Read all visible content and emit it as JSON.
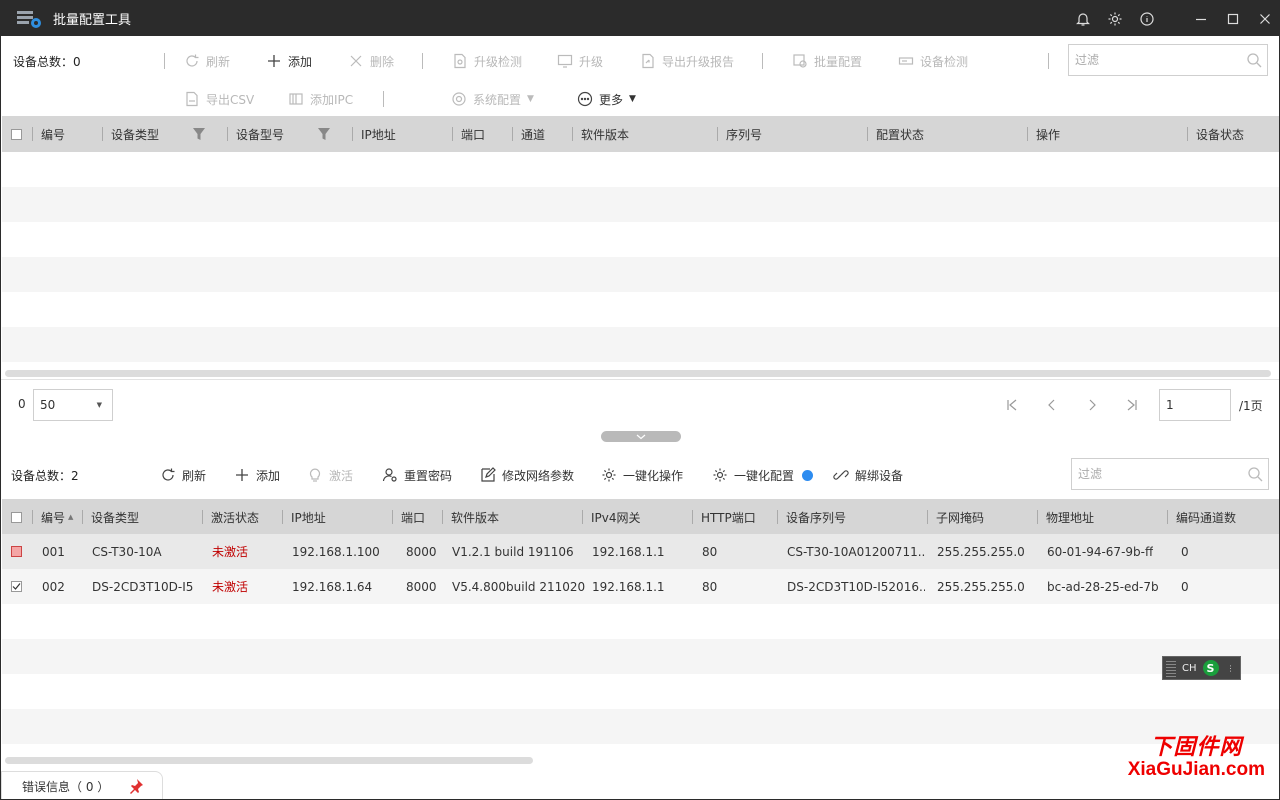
{
  "titlebar": {
    "title": "批量配置工具"
  },
  "top": {
    "total_label": "设备总数：0",
    "toolbar_row1": [
      "刷新",
      "添加",
      "删除",
      "升级检测",
      "升级",
      "导出升级报告",
      "批量配置",
      "设备检测"
    ],
    "toolbar_row2": [
      "导出CSV",
      "添加IPC",
      "系统配置",
      "更多"
    ],
    "filter_placeholder": "过滤",
    "columns": [
      "编号",
      "设备类型",
      "设备型号",
      "IP地址",
      "端口",
      "通道",
      "软件版本",
      "序列号",
      "配置状态",
      "操作",
      "设备状态"
    ]
  },
  "pager": {
    "count": "0",
    "page_size": "50",
    "page": "1",
    "page_total": "/1页"
  },
  "bottom": {
    "total_label": "设备总数：2",
    "toolbar": [
      "刷新",
      "添加",
      "激活",
      "重置密码",
      "修改网络参数",
      "一键化操作",
      "一键化配置",
      "解绑设备"
    ],
    "filter_placeholder": "过滤",
    "columns": [
      "编号",
      "设备类型",
      "激活状态",
      "IP地址",
      "端口",
      "软件版本",
      "IPv4网关",
      "HTTP端口",
      "设备序列号",
      "子网掩码",
      "物理地址",
      "编码通道数"
    ],
    "rows": [
      {
        "id": "001",
        "type": "CS-T30-10A",
        "status": "未激活",
        "ip": "192.168.1.100",
        "port": "8000",
        "version": "V1.2.1 build 191106",
        "gateway": "192.168.1.1",
        "http": "80",
        "serial": "CS-T30-10A01200711...",
        "mask": "255.255.255.0",
        "mac": "60-01-94-67-9b-ff",
        "channels": "0"
      },
      {
        "id": "002",
        "type": "DS-2CD3T10D-I5",
        "status": "未激活",
        "ip": "192.168.1.64",
        "port": "8000",
        "version": "V5.4.800build 211020",
        "gateway": "192.168.1.1",
        "http": "80",
        "serial": "DS-2CD3T10D-I52016...",
        "mask": "255.255.255.0",
        "mac": "bc-ad-28-25-ed-7b",
        "channels": "0"
      }
    ]
  },
  "ime": {
    "label": "CH"
  },
  "statusbar": {
    "label": "错误信息（ 0 ）"
  },
  "watermark": {
    "cn": "下固件网",
    "en": "XiaGuJian.com"
  },
  "colors": {
    "titlebar": "#2b2b2b",
    "header": "#d6d6d6",
    "inactive": "#c00000",
    "watermark": "#e00000"
  }
}
